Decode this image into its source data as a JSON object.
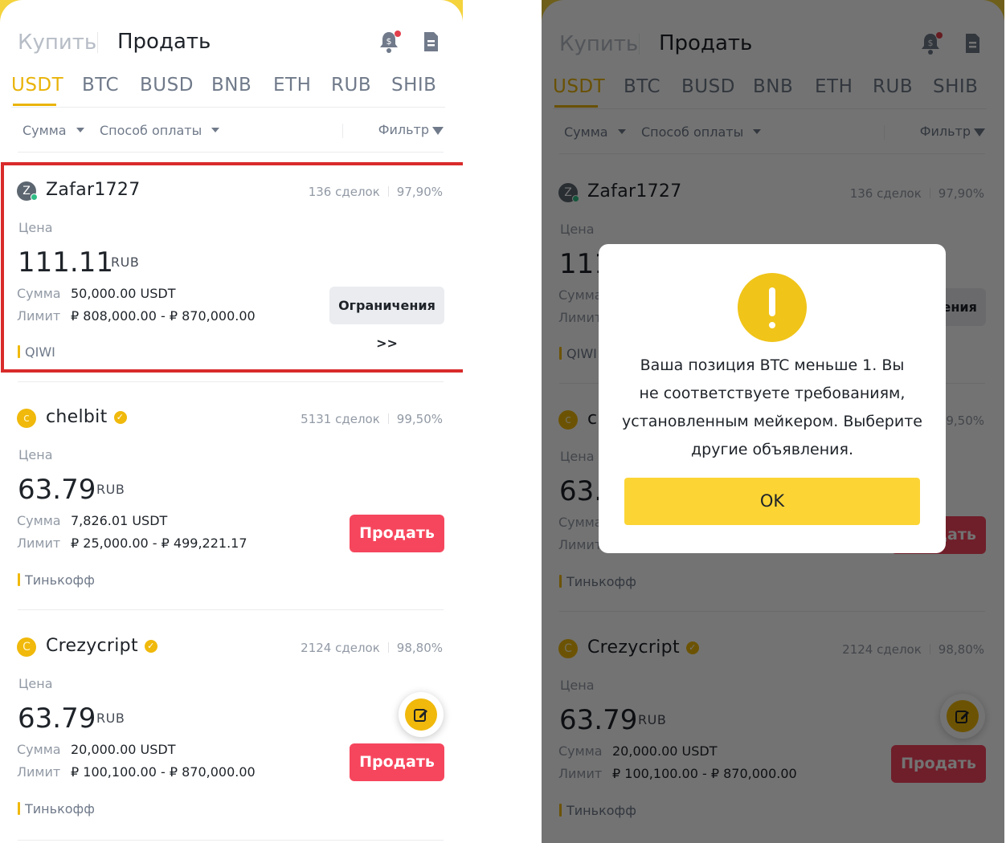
{
  "header": {
    "tab_buy": "Купить",
    "tab_sell": "Продать",
    "notification_icon": "bell-dollar-icon",
    "orders_icon": "document-icon"
  },
  "assets": [
    "USDT",
    "BTC",
    "BUSD",
    "BNB",
    "ETH",
    "RUB",
    "SHIB"
  ],
  "active_asset": "USDT",
  "filters": {
    "amount": "Сумма",
    "payment_method": "Способ оплаты",
    "filter": "Фильтр"
  },
  "ads": [
    {
      "initial": "Z",
      "nick": "Zafar1727",
      "verified": false,
      "online": true,
      "trades": "136 сделок",
      "completion": "97,90%",
      "price_label": "Цена",
      "price": "111.11",
      "currency": "RUB",
      "amount_label": "Сумма",
      "amount": "50,000.00 USDT",
      "limit_label": "Лимит",
      "limit": "₽ 808,000.00 - ₽ 870,000.00",
      "payment": "QIWI",
      "button": "Ограничения >>"
    },
    {
      "initial": "c",
      "nick": "chelbit",
      "verified": true,
      "online": false,
      "trades": "5131 сделок",
      "completion": "99,50%",
      "price_label": "Цена",
      "price": "63.79",
      "currency": "RUB",
      "amount_label": "Сумма",
      "amount": "7,826.01 USDT",
      "limit_label": "Лимит",
      "limit": "₽ 25,000.00 - ₽ 499,221.17",
      "payment": "Тинькофф",
      "button": "Продать"
    },
    {
      "initial": "C",
      "nick": "Crezycript",
      "verified": true,
      "online": false,
      "trades": "2124 сделок",
      "completion": "98,80%",
      "price_label": "Цена",
      "price": "63.79",
      "currency": "RUB",
      "amount_label": "Сумма",
      "amount": "20,000.00 USDT",
      "limit_label": "Лимит",
      "limit": "₽ 100,100.00 - ₽ 870,000.00",
      "payment": "Тинькофф",
      "button": "Продать"
    }
  ],
  "fab_icon": "edit-icon",
  "modal": {
    "icon": "exclamation-icon",
    "line1": "Ваша позиция BTC меньше 1. Вы",
    "line2": "не соответствуете требованиям,",
    "line3": "установленным мейкером. Выберите",
    "line4": "другие объявления.",
    "ok": "OK"
  },
  "colors": {
    "accent": "#f0b90b",
    "sell": "#f6465d",
    "highlight": "#d92b2b",
    "modal_button": "#fcd535"
  }
}
